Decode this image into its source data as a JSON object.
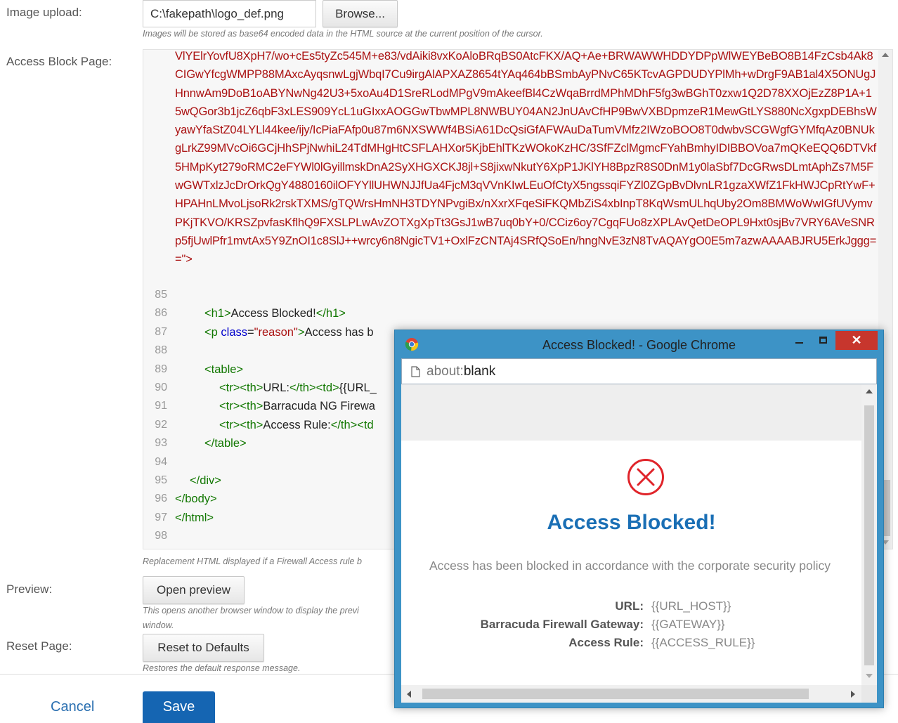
{
  "form": {
    "image_upload": {
      "label": "Image upload:",
      "value": "C:\\fakepath\\logo_def.png",
      "browse_label": "Browse...",
      "help": "Images will be stored as base64 encoded data in the HTML source at the current position of the cursor."
    },
    "access_block": {
      "label": "Access Block Page:",
      "help": "Replacement HTML displayed if a Firewall Access rule b"
    },
    "preview": {
      "label": "Preview:",
      "button": "Open preview",
      "help_line1": "This opens another browser window to display the previ",
      "help_line2": "window."
    },
    "reset": {
      "label": "Reset Page:",
      "button": "Reset to Defaults",
      "help": "Restores the default response message."
    }
  },
  "editor": {
    "base64_text": "VlYElrYovfU8XpH7/wo+cEs5tyZc545M+e83/vdAiki8vxKoAloBRqBS0AtcFKX/AQ+Ae+BRWAWWHDDYDPpWlWEYBeBO8B14FzCsb4Ak8CIGwYfcgWMPP88MAxcAyqsnwLgjWbqI7Cu9irgAlAPXAZ8654tYAq464bBSmbAyPNvC65KTcvAGPDUDYPlMh+wDrgF9AB1al4X5ONUgJHnnwAm9DoB1oABYNwNg42U3+5xoAu4D1SreRLodMPgV9mAkeefBl4CzWqaBrrdMPhMDhF5fg3wBGhT0zxw1Q2D78XXOjEzZ8P1A+15wQGor3b1jcZ6qbF3xLES909YcL1uGIxxAOGGwTbwMPL8NWBUY04AN2JnUAvCfHP9BwVXBDpmzeR1MewGtLYS880NcXgxpDEBhsWyawYfaStZ04LYLl44kee/ijy/IcPiaFAfp0u87m6NXSWWf4BSiA61DcQsiGfAFWAuDaTumVMfz2IWzoBOO8T0dwbvSCGWgfGYMfqAz0BNUkgLrkZ99MVcOi6GCjHhSPjNwhiL24TdMHgHtCSFLAHXor5KjbEhlTKzWOkoKzHC/3SfFZclMgmcFYahBmhyIDIBBOVoa7mQKeEQQ6DTVkf5HMpKyt279oRMC2eFYWl0lGyillmskDnA2SyXHGXCKJ8jl+S8jixwNkutY6XpP1JKlYH8BpzR8S0DnM1y0laSbf7DcGRwsDLmtAphZs7M5FwGWTxlzJcDrOrkQgY4880160ilOFYYllUHWNJJfUa4FjcM3qVVnKIwLEuOfCtyX5ngssqiFYZl0ZGpBvDlvnLR1gzaXWfZ1FkHWJCpRtYwF+HPAHnLMvoLjsoRk2rskTXMS/gTQWrsHmNH3TDYNPvgiBx/nXxrXFqeSiFKQMbZiS4xbInpT8KqWsmULhqUby2Om8BMWoWwIGfUVymvPKjTKVO/KRSZpvfasKflhQ9FXSLPLwAvZOTXgXpTt3GsJ1wB7uq0bY+0/CCiz6oy7CgqFUo8zXPLAvQetDeOPL9Hxt0sjBv7VRY6AVeSNRp5fjUwlPfr1mvtAx5Y9ZnOI1c8SlJ++wrcy6n8NgicTV1+OxlFzCNTAj4SRfQSoEn/hngNvE3zN8TvAQAYgO0E5m7azwAAAABJRU5ErkJggg==\">",
    "line_numbers": [
      "85",
      "86",
      "87",
      "88",
      "89",
      "90",
      "91",
      "92",
      "93",
      "94",
      "95",
      "96",
      "97",
      "98"
    ],
    "lines": {
      "l86": {
        "open": "<h1>",
        "text": "Access Blocked!",
        "close": "</h1>"
      },
      "l87": {
        "open": "<p ",
        "attr": "class",
        "eq": "=",
        "val": "\"reason\"",
        "gt": ">",
        "text": "Access has b"
      },
      "l89": {
        "tag": "<table>"
      },
      "l90": {
        "open": "<tr><th>",
        "text": "URL:",
        "mid": "</th><td>",
        "rest": "{{URL_"
      },
      "l91": {
        "open": "<tr><th>",
        "text": "Barracuda NG Firewa"
      },
      "l92": {
        "open": "<tr><th>",
        "text": "Access Rule:",
        "mid": "</th><td"
      },
      "l93": {
        "tag": "</table>"
      },
      "l95": {
        "tag": "</div>"
      },
      "l96": {
        "tag": "</body>"
      },
      "l97": {
        "tag": "</html>"
      }
    }
  },
  "popup": {
    "title": "Access Blocked! - Google Chrome",
    "address_scheme": "about:",
    "address_path": "blank",
    "heading": "Access Blocked!",
    "reason": "Access has been blocked in accordance with the corporate security policy",
    "rows": [
      {
        "label": "URL:",
        "value": "{{URL_HOST}}"
      },
      {
        "label": "Barracuda Firewall Gateway:",
        "value": "{{GATEWAY}}"
      },
      {
        "label": "Access Rule:",
        "value": "{{ACCESS_RULE}}"
      }
    ],
    "accent": "#1a6fb5",
    "error_color": "#e0242a"
  },
  "footer": {
    "cancel": "Cancel",
    "save": "Save"
  },
  "icons": [
    "chrome-logo-icon",
    "page-icon",
    "error-x-icon",
    "minimize-icon",
    "maximize-icon",
    "close-icon",
    "scroll-up-icon",
    "scroll-down-icon",
    "scroll-left-icon",
    "scroll-right-icon"
  ]
}
